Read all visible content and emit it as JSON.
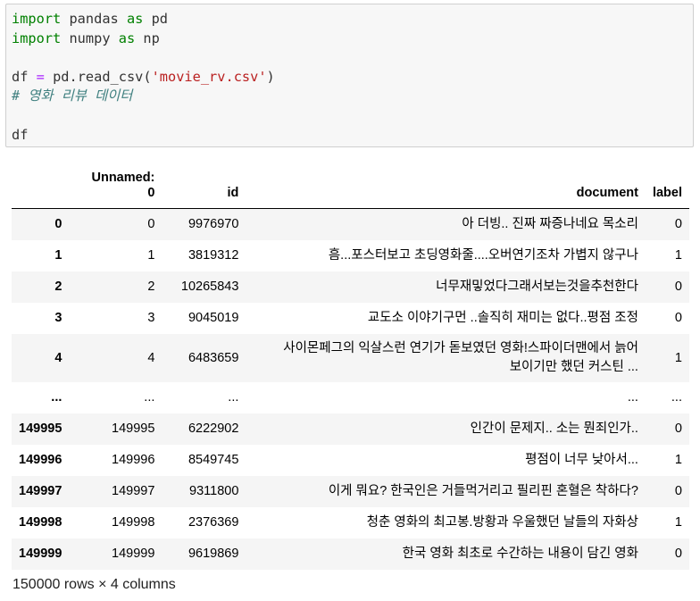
{
  "code_cell": {
    "lines": [
      {
        "parts": [
          {
            "t": "import",
            "c": "kw"
          },
          {
            "t": " pandas ",
            "c": ""
          },
          {
            "t": "as",
            "c": "kw"
          },
          {
            "t": " pd",
            "c": ""
          }
        ]
      },
      {
        "parts": [
          {
            "t": "import",
            "c": "kw"
          },
          {
            "t": " numpy ",
            "c": ""
          },
          {
            "t": "as",
            "c": "kw"
          },
          {
            "t": " np",
            "c": ""
          }
        ]
      },
      {
        "parts": []
      },
      {
        "parts": [
          {
            "t": "df ",
            "c": ""
          },
          {
            "t": "=",
            "c": "op"
          },
          {
            "t": " pd.read_csv(",
            "c": ""
          },
          {
            "t": "'movie_rv.csv'",
            "c": "str"
          },
          {
            "t": ")",
            "c": ""
          }
        ]
      },
      {
        "parts": [
          {
            "t": "# 영화 리뷰 데이터",
            "c": "cm"
          }
        ]
      },
      {
        "parts": []
      },
      {
        "parts": [
          {
            "t": "df",
            "c": ""
          }
        ]
      }
    ]
  },
  "dataframe": {
    "columns": [
      "",
      "Unnamed: 0",
      "id",
      "document",
      "label"
    ],
    "unnamed_header": {
      "line1": "Unnamed:",
      "line2": "0"
    },
    "rows": [
      {
        "index": "0",
        "unnamed": "0",
        "id": "9976970",
        "document": "아 더빙.. 진짜 짜증나네요 목소리",
        "label": "0"
      },
      {
        "index": "1",
        "unnamed": "1",
        "id": "3819312",
        "document": "흠...포스터보고 초딩영화줄....오버연기조차 가볍지 않구나",
        "label": "1"
      },
      {
        "index": "2",
        "unnamed": "2",
        "id": "10265843",
        "document": "너무재밓었다그래서보는것을추천한다",
        "label": "0"
      },
      {
        "index": "3",
        "unnamed": "3",
        "id": "9045019",
        "document": "교도소 이야기구먼 ..솔직히 재미는 없다..평점 조정",
        "label": "0"
      },
      {
        "index": "4",
        "unnamed": "4",
        "id": "6483659",
        "document": "사이몬페그의 익살스런 연기가 돋보였던 영화!스파이더맨에서 늙어\n보이기만 했던 커스틴 ...",
        "label": "1",
        "tall": true
      },
      {
        "index": "...",
        "unnamed": "...",
        "id": "...",
        "document": "...",
        "label": "..."
      },
      {
        "index": "149995",
        "unnamed": "149995",
        "id": "6222902",
        "document": "인간이 문제지.. 소는 뭔죄인가..",
        "label": "0"
      },
      {
        "index": "149996",
        "unnamed": "149996",
        "id": "8549745",
        "document": "평점이 너무 낮아서...",
        "label": "1"
      },
      {
        "index": "149997",
        "unnamed": "149997",
        "id": "9311800",
        "document": "이게 뭐요? 한국인은 거들먹거리고 필리핀 혼혈은 착하다?",
        "label": "0"
      },
      {
        "index": "149998",
        "unnamed": "149998",
        "id": "2376369",
        "document": "청춘 영화의 최고봉.방황과 우울했던 날들의 자화상",
        "label": "1"
      },
      {
        "index": "149999",
        "unnamed": "149999",
        "id": "9619869",
        "document": "한국 영화 최초로 수간하는 내용이 담긴 영화",
        "label": "0"
      }
    ]
  },
  "footer": {
    "shape": "150000 rows × 4 columns"
  }
}
